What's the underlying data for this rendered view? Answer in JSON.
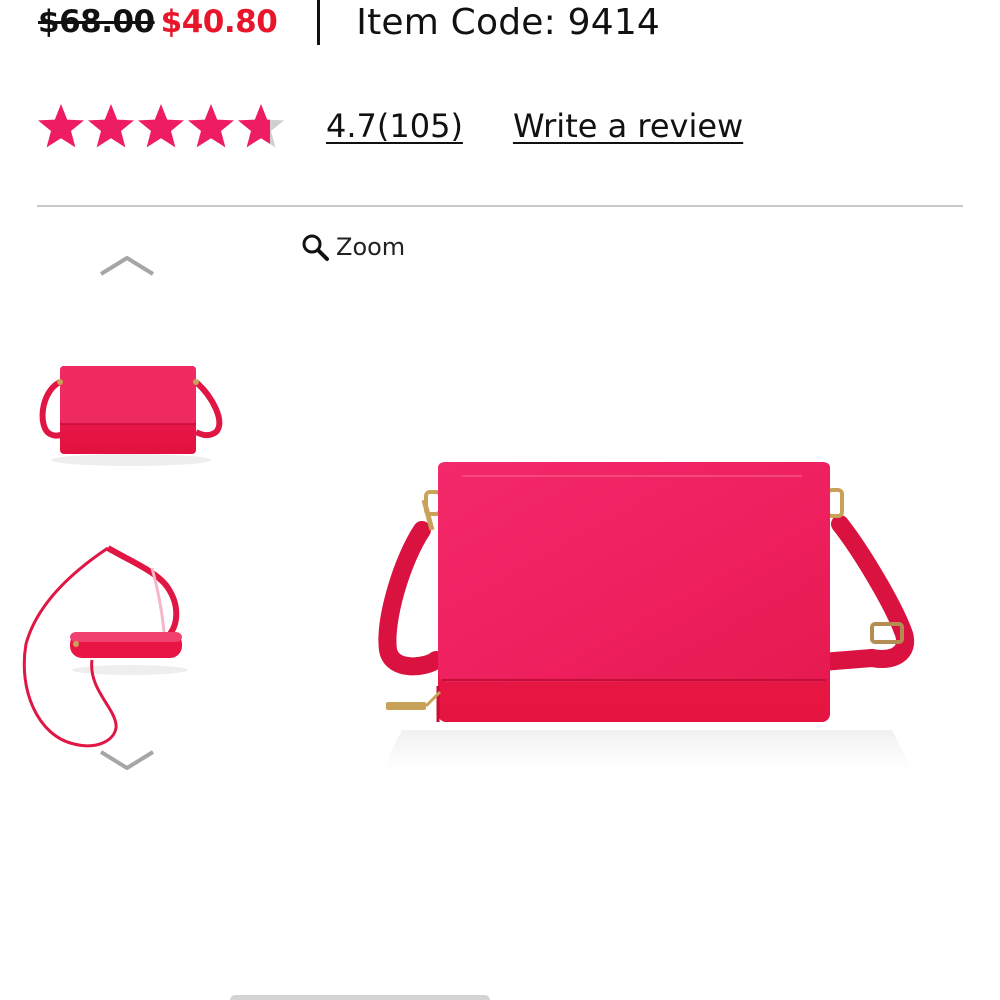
{
  "product": {
    "old_price": "$68.00",
    "sale_price": "$40.80",
    "item_code": "Item Code: 9414"
  },
  "rating": {
    "stars_value": 4.7,
    "stars_max": 5,
    "summary_link": "4.7(105)",
    "write_review": "Write a review"
  },
  "gallery": {
    "zoom_label": "Zoom",
    "zoom_icon": "magnifier-icon",
    "prev_icon": "chevron-up-icon",
    "next_icon": "chevron-down-icon",
    "thumbnails": [
      "front-view",
      "strap-view"
    ],
    "selected_thumbnail": 0
  },
  "colors": {
    "sale_price": "#e8162b",
    "star": "#ee1c63",
    "star_empty": "#cfcfcf",
    "bag": "#e81545",
    "chevron": "#9a9a9a"
  }
}
